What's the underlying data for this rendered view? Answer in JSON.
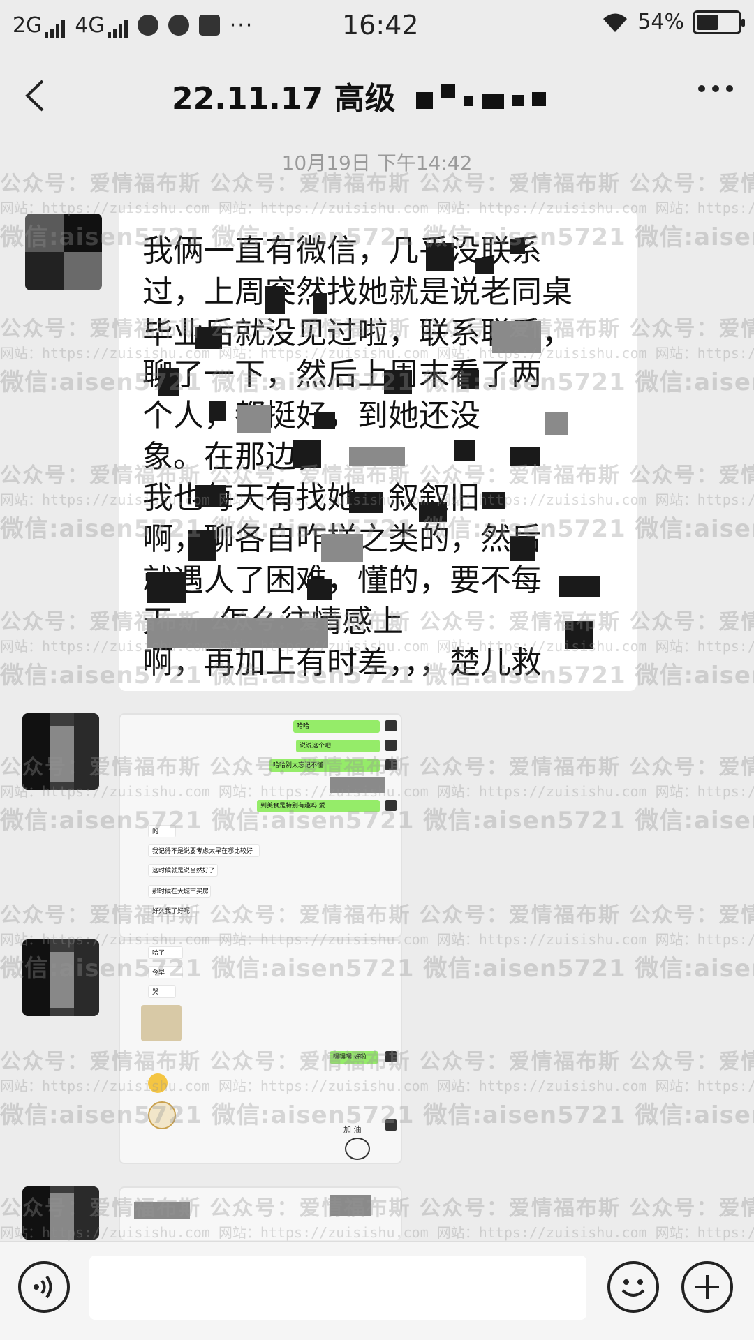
{
  "status_bar": {
    "network_1": "2G",
    "network_2": "4G",
    "time": "16:42",
    "battery": "54%",
    "battery_level": 0.54
  },
  "header": {
    "title": "22.11.17 高级"
  },
  "chat": {
    "timestamp": "10月19日 下午14:42",
    "message_lines": [
      "我俩一直有微信，几乎没联系",
      "过，上周突然找她就是说老同桌",
      "毕业后就没见过啦，联系联系，",
      "聊了一下，然后上周末看了两",
      "个人，都挺好，到她还没",
      "象。在那边，",
      "我也每天有找她，叙叙旧",
      "啊，聊各自咋样之类的，然后",
      "就遇人了困难，懂的，要不每",
      "天，，怎么往情感上",
      "啊，再加上有时差，，，楚儿救"
    ],
    "screenshot_1": {
      "green_bubbles": [
        "哈哈",
        "说说这个吧",
        "哈哈别太忘记不懂",
        "到美食是特别有趣吗 爱"
      ],
      "white_bubbles": [
        "的",
        "我记得不是说要考虑太早在哪比较好",
        "这时候就是说当然好了",
        "那时候在大城市买房",
        "好久我了好呢"
      ]
    },
    "screenshot_2": {
      "white_bubbles": [
        "哈了",
        "今早",
        "哭"
      ],
      "green_bubbles": [
        "嘿嘿嘿 好啦"
      ],
      "sticker_text": "加 油"
    }
  },
  "watermark": {
    "line1": "公众号：爱情福布斯 公众号：爱情福布斯 公众号：爱情福布斯 公众号：爱情福布斯 公众号：爱情福布斯",
    "line2": "网站：https://zuisishu.com 网站：https://zuisishu.com 网站：https://zuisishu.com 网站：https://zuisishu.com",
    "line3": "微信:aisen5721 微信:aisen5721 微信:aisen5721 微信:aisen5721 微信:aisen5721"
  }
}
